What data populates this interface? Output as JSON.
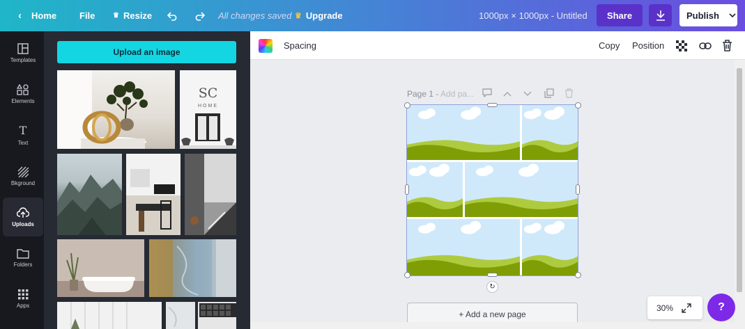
{
  "topbar": {
    "home_label": "Home",
    "file_label": "File",
    "resize_label": "Resize",
    "saved_status": "All changes saved",
    "upgrade_label": "Upgrade",
    "doc_title": "1000px × 1000px - Untitled",
    "share_label": "Share",
    "publish_label": "Publish"
  },
  "rail": {
    "items": [
      {
        "label": "Templates",
        "icon": "templates-icon"
      },
      {
        "label": "Elements",
        "icon": "elements-icon"
      },
      {
        "label": "Text",
        "icon": "text-icon"
      },
      {
        "label": "Bkground",
        "icon": "background-icon"
      },
      {
        "label": "Uploads",
        "icon": "uploads-icon",
        "active": true
      },
      {
        "label": "Folders",
        "icon": "folder-icon"
      },
      {
        "label": "Apps",
        "icon": "apps-icon"
      }
    ]
  },
  "panel": {
    "upload_label": "Upload an image",
    "logo_letters": "SC",
    "logo_word": "HOME"
  },
  "toolbar": {
    "spacing_label": "Spacing",
    "copy_label": "Copy",
    "position_label": "Position"
  },
  "canvas": {
    "page_label": "Page 1 - ",
    "page_placeholder": "Add pa...",
    "add_page_label": "+ Add a new page"
  },
  "zoom": {
    "level": "30%"
  },
  "help": {
    "label": "?"
  },
  "colors": {
    "accent": "#7d2ae8",
    "upload_button": "#13d6e2",
    "sky": "#cfe9fb",
    "grass": "#7f9e05"
  }
}
